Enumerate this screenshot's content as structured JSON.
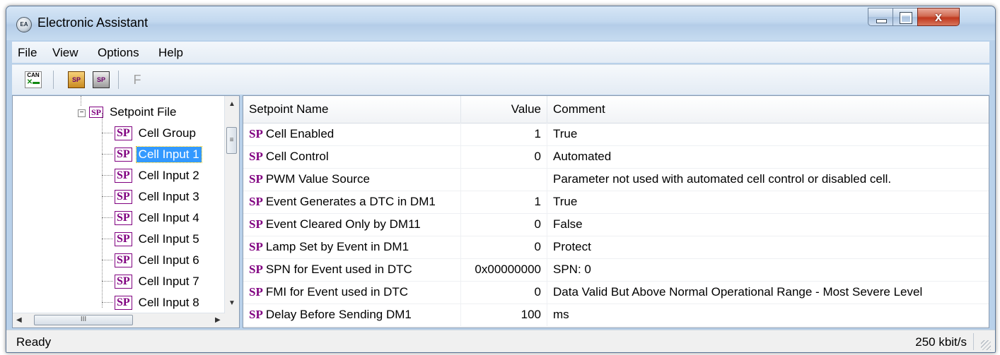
{
  "window": {
    "title": "Electronic Assistant",
    "app_icon_text": "EA",
    "close_glyph": "x"
  },
  "menu": [
    "File",
    "View",
    "Options",
    "Help"
  ],
  "toolbar": {
    "can_top": "CAN",
    "can_bottom": "✕▬",
    "sp1": "SP",
    "sp2": "SP",
    "f_label": "F"
  },
  "tree": {
    "root": {
      "badge": "SP",
      "label": "Setpoint File"
    },
    "items": [
      {
        "badge": "SP",
        "label": "Cell Group",
        "selected": false
      },
      {
        "badge": "SP",
        "label": "Cell Input 1",
        "selected": true
      },
      {
        "badge": "SP",
        "label": "Cell Input 2",
        "selected": false
      },
      {
        "badge": "SP",
        "label": "Cell Input 3",
        "selected": false
      },
      {
        "badge": "SP",
        "label": "Cell Input 4",
        "selected": false
      },
      {
        "badge": "SP",
        "label": "Cell Input 5",
        "selected": false
      },
      {
        "badge": "SP",
        "label": "Cell Input 6",
        "selected": false
      },
      {
        "badge": "SP",
        "label": "Cell Input 7",
        "selected": false
      },
      {
        "badge": "SP",
        "label": "Cell Input 8",
        "selected": false
      }
    ],
    "scroll": {
      "up": "▲",
      "down": "▼",
      "left": "◀",
      "right": "▶",
      "thumb_v": "≡",
      "thumb_h": "III"
    }
  },
  "grid": {
    "columns": [
      "Setpoint Name",
      "Value",
      "Comment"
    ],
    "rows": [
      {
        "prefix": "SP",
        "name": "Cell Enabled",
        "value": "1",
        "comment": "True"
      },
      {
        "prefix": "SP",
        "name": "Cell Control",
        "value": "0",
        "comment": "Automated"
      },
      {
        "prefix": "SP",
        "name": "PWM Value Source",
        "value": "",
        "comment": "Parameter not used with automated cell control or disabled cell."
      },
      {
        "prefix": "SP",
        "name": "Event Generates a DTC in DM1",
        "value": "1",
        "comment": "True"
      },
      {
        "prefix": "SP",
        "name": "Event Cleared Only by DM11",
        "value": "0",
        "comment": "False"
      },
      {
        "prefix": "SP",
        "name": "Lamp Set by Event in DM1",
        "value": "0",
        "comment": "Protect"
      },
      {
        "prefix": "SP",
        "name": "SPN for Event used in DTC",
        "value": "0x00000000",
        "comment": "SPN: 0"
      },
      {
        "prefix": "SP",
        "name": "FMI for Event used in DTC",
        "value": "0",
        "comment": "Data Valid But Above Normal Operational Range - Most Severe Level"
      },
      {
        "prefix": "SP",
        "name": "Delay Before Sending DM1",
        "value": "100",
        "comment": "ms"
      }
    ]
  },
  "status": {
    "left": "Ready",
    "right": "250 kbit/s"
  }
}
